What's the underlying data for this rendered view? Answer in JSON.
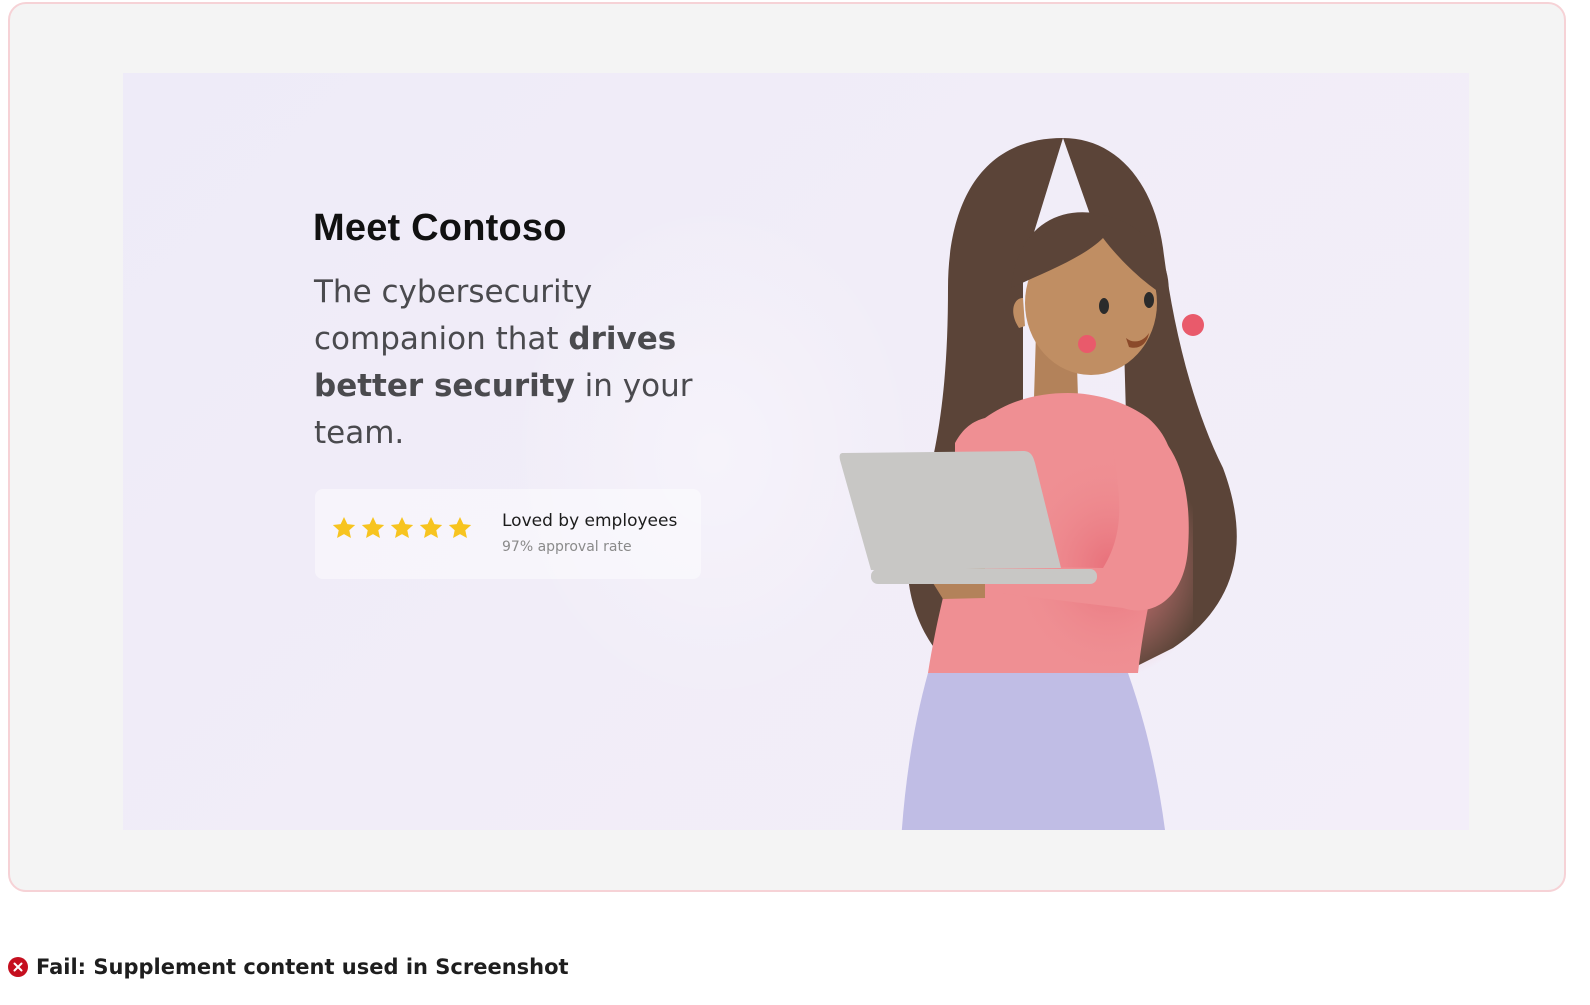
{
  "hero": {
    "title": "Meet Contoso",
    "tagline": {
      "part1": "The cybersecurity companion that ",
      "bold": "drives better security",
      "part2": " in your team."
    },
    "rating": {
      "stars": 5,
      "max_stars": 5,
      "title": "Loved by employees",
      "subtitle": "97% approval rate"
    },
    "illustration": "woman-with-laptop-illustration"
  },
  "status": {
    "icon": "fail-icon",
    "text": "Fail: Supplement content used in Screenshot",
    "color": "#c50f1f"
  },
  "colors": {
    "star": "#f7c41f",
    "frame_border": "#f6d2d6",
    "hero_bg": "#efecf8"
  }
}
